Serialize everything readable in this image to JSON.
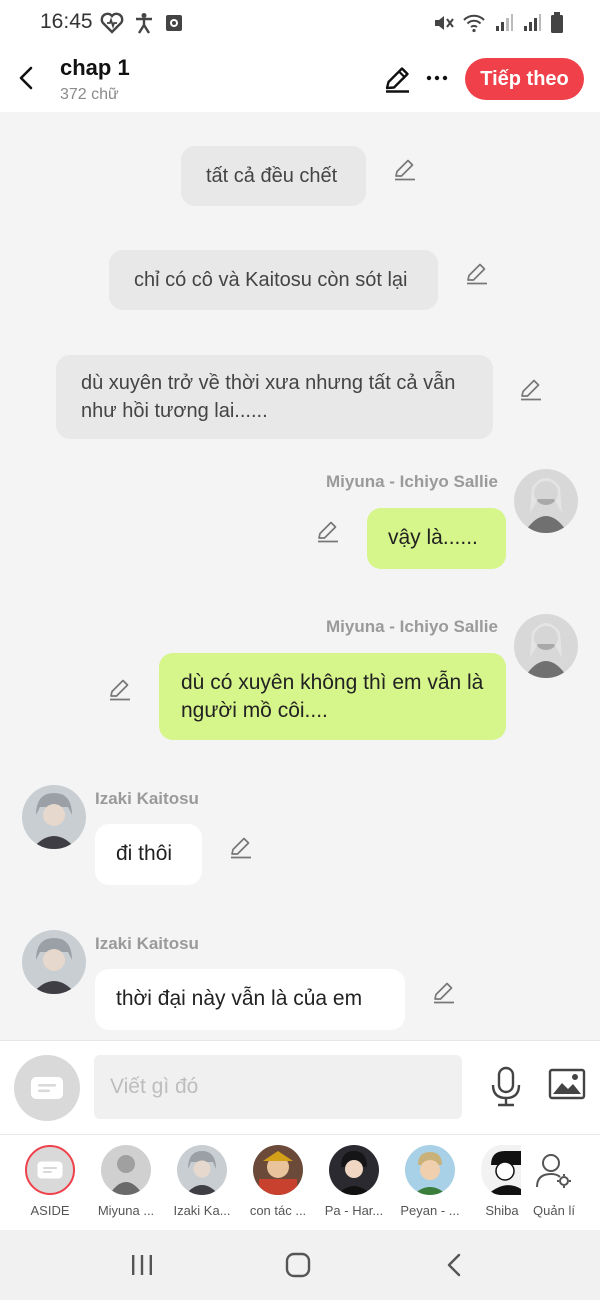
{
  "status_bar": {
    "time": "16:45"
  },
  "header": {
    "title": "chap 1",
    "word_count": "372 chữ",
    "next_label": "Tiếp theo"
  },
  "colors": {
    "accent": "#f0414a",
    "right_bubble": "#d6f58a",
    "narration_bubble": "#e8e8e8"
  },
  "messages": [
    {
      "type": "narration",
      "text": "tất cả đều chết"
    },
    {
      "type": "narration",
      "text": "chỉ có cô và Kaitosu còn sót lại"
    },
    {
      "type": "narration",
      "text": "dù xuyên trở về thời xưa nhưng tất cả vẫn như hồi tương lai......"
    },
    {
      "type": "right",
      "speaker": "Miyuna - Ichiyo Sallie",
      "text": "vậy là......"
    },
    {
      "type": "right",
      "speaker": "Miyuna - Ichiyo Sallie",
      "text": "dù có xuyên không thì em vẫn là người mồ côi...."
    },
    {
      "type": "left",
      "speaker": "Izaki Kaitosu",
      "text": "đi thôi"
    },
    {
      "type": "left",
      "speaker": "Izaki Kaitosu",
      "text": "thời đại này vẫn là của em"
    }
  ],
  "composer": {
    "placeholder": "Viết gì đó"
  },
  "characters": [
    {
      "label": "ASIDE"
    },
    {
      "label": "Miyuna ..."
    },
    {
      "label": "Izaki Ka..."
    },
    {
      "label": "con tác ..."
    },
    {
      "label": "Pa - Har..."
    },
    {
      "label": "Peyan - ..."
    },
    {
      "label": "Shiba"
    },
    {
      "label": "Quản lí"
    }
  ]
}
